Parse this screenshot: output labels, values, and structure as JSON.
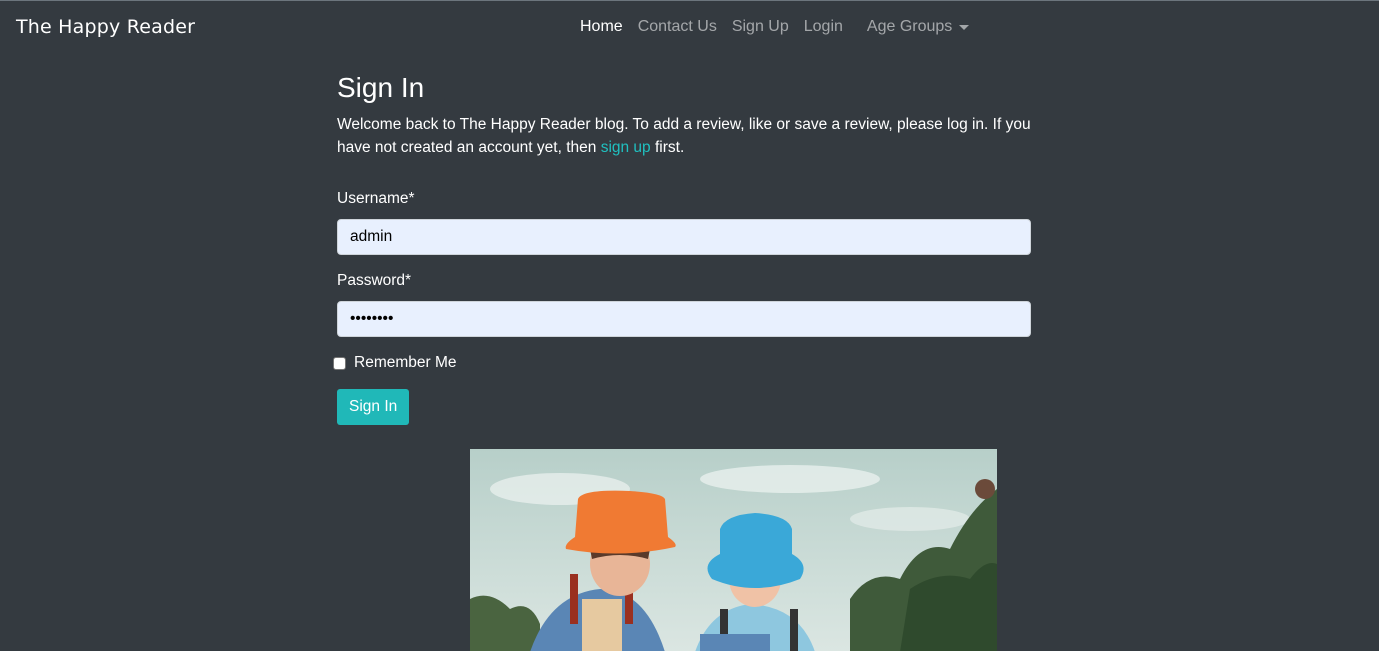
{
  "navbar": {
    "brand": "The Happy Reader",
    "links": [
      {
        "label": "Home"
      },
      {
        "label": "Contact Us"
      },
      {
        "label": "Sign Up"
      },
      {
        "label": "Login"
      }
    ],
    "dropdown_label": "Age Groups"
  },
  "signin": {
    "title": "Sign In",
    "intro_before": "Welcome back to The Happy Reader blog. To add a review, like or save a review, please log in. If you have not created an account yet, then ",
    "intro_link": "sign up",
    "intro_after": " first.",
    "username_label": "Username*",
    "username_value": "admin",
    "password_label": "Password*",
    "password_value": "••••••••",
    "remember_label": "Remember Me",
    "remember_checked": false,
    "submit_label": "Sign In"
  },
  "colors": {
    "background": "#343a40",
    "accent": "#20b8b8",
    "input_bg": "#e8f0fe"
  }
}
